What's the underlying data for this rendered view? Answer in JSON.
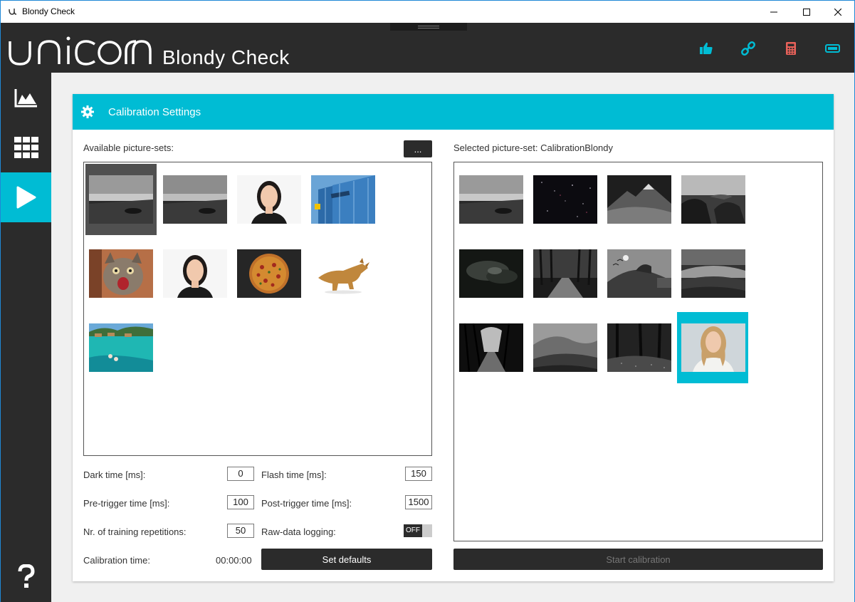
{
  "window": {
    "title": "Blondy Check",
    "controls": [
      "minimize",
      "maximize",
      "close"
    ]
  },
  "header": {
    "logo": "unicorn",
    "app_name": "Blondy Check",
    "icons": [
      {
        "name": "thumbs-up-icon",
        "color": "#00bcd4"
      },
      {
        "name": "link-icon",
        "color": "#00bcd4"
      },
      {
        "name": "calculator-icon",
        "color": "#e8615a"
      },
      {
        "name": "battery-icon",
        "color": "#00bcd4"
      }
    ]
  },
  "sidebar": {
    "items": [
      {
        "name": "chart-icon",
        "active": false
      },
      {
        "name": "grid-icon",
        "active": false
      },
      {
        "name": "play-icon",
        "active": true
      },
      {
        "name": "help-icon",
        "active": false
      }
    ]
  },
  "card": {
    "title": "Calibration Settings",
    "available_label": "Available picture-sets:",
    "browse_label": "...",
    "selected_label": "Selected picture-set: CalibrationBlondy",
    "available_thumbs": [
      {
        "name": "beach-boat-bw",
        "selected": true
      },
      {
        "name": "beach-boat-bw-2",
        "selected": false
      },
      {
        "name": "woman-portrait",
        "selected": false
      },
      {
        "name": "office-building",
        "selected": false
      },
      {
        "name": "cat",
        "selected": false
      },
      {
        "name": "woman-portrait-2",
        "selected": false
      },
      {
        "name": "pizza",
        "selected": false
      },
      {
        "name": "dinosaur-toy",
        "selected": false
      },
      {
        "name": "tropical-lagoon",
        "selected": false
      }
    ],
    "selected_thumbs": [
      {
        "name": "beach-boat-bw",
        "selected": false
      },
      {
        "name": "night-sky",
        "selected": false
      },
      {
        "name": "mountains-bw",
        "selected": false
      },
      {
        "name": "rocky-coast-bw",
        "selected": false
      },
      {
        "name": "dark-clouds",
        "selected": false
      },
      {
        "name": "forest-path-bw",
        "selected": false
      },
      {
        "name": "hillside-moon-bw",
        "selected": false
      },
      {
        "name": "misty-hills-bw",
        "selected": false
      },
      {
        "name": "dark-forest-path",
        "selected": false
      },
      {
        "name": "valley-bw",
        "selected": false
      },
      {
        "name": "dark-woods",
        "selected": false
      },
      {
        "name": "blonde-woman",
        "selected": true
      }
    ],
    "settings": {
      "dark_time_label": "Dark time [ms]:",
      "dark_time": "0",
      "flash_time_label": "Flash time [ms]:",
      "flash_time": "150",
      "pre_trigger_label": "Pre-trigger time [ms]:",
      "pre_trigger": "100",
      "post_trigger_label": "Post-trigger time [ms]:",
      "post_trigger": "1500",
      "repetitions_label": "Nr. of training repetitions:",
      "repetitions": "50",
      "raw_logging_label": "Raw-data logging:",
      "raw_logging": "OFF",
      "calibration_time_label": "Calibration time:",
      "calibration_time": "00:00:00"
    },
    "set_defaults_label": "Set defaults",
    "start_calibration_label": "Start calibration"
  }
}
